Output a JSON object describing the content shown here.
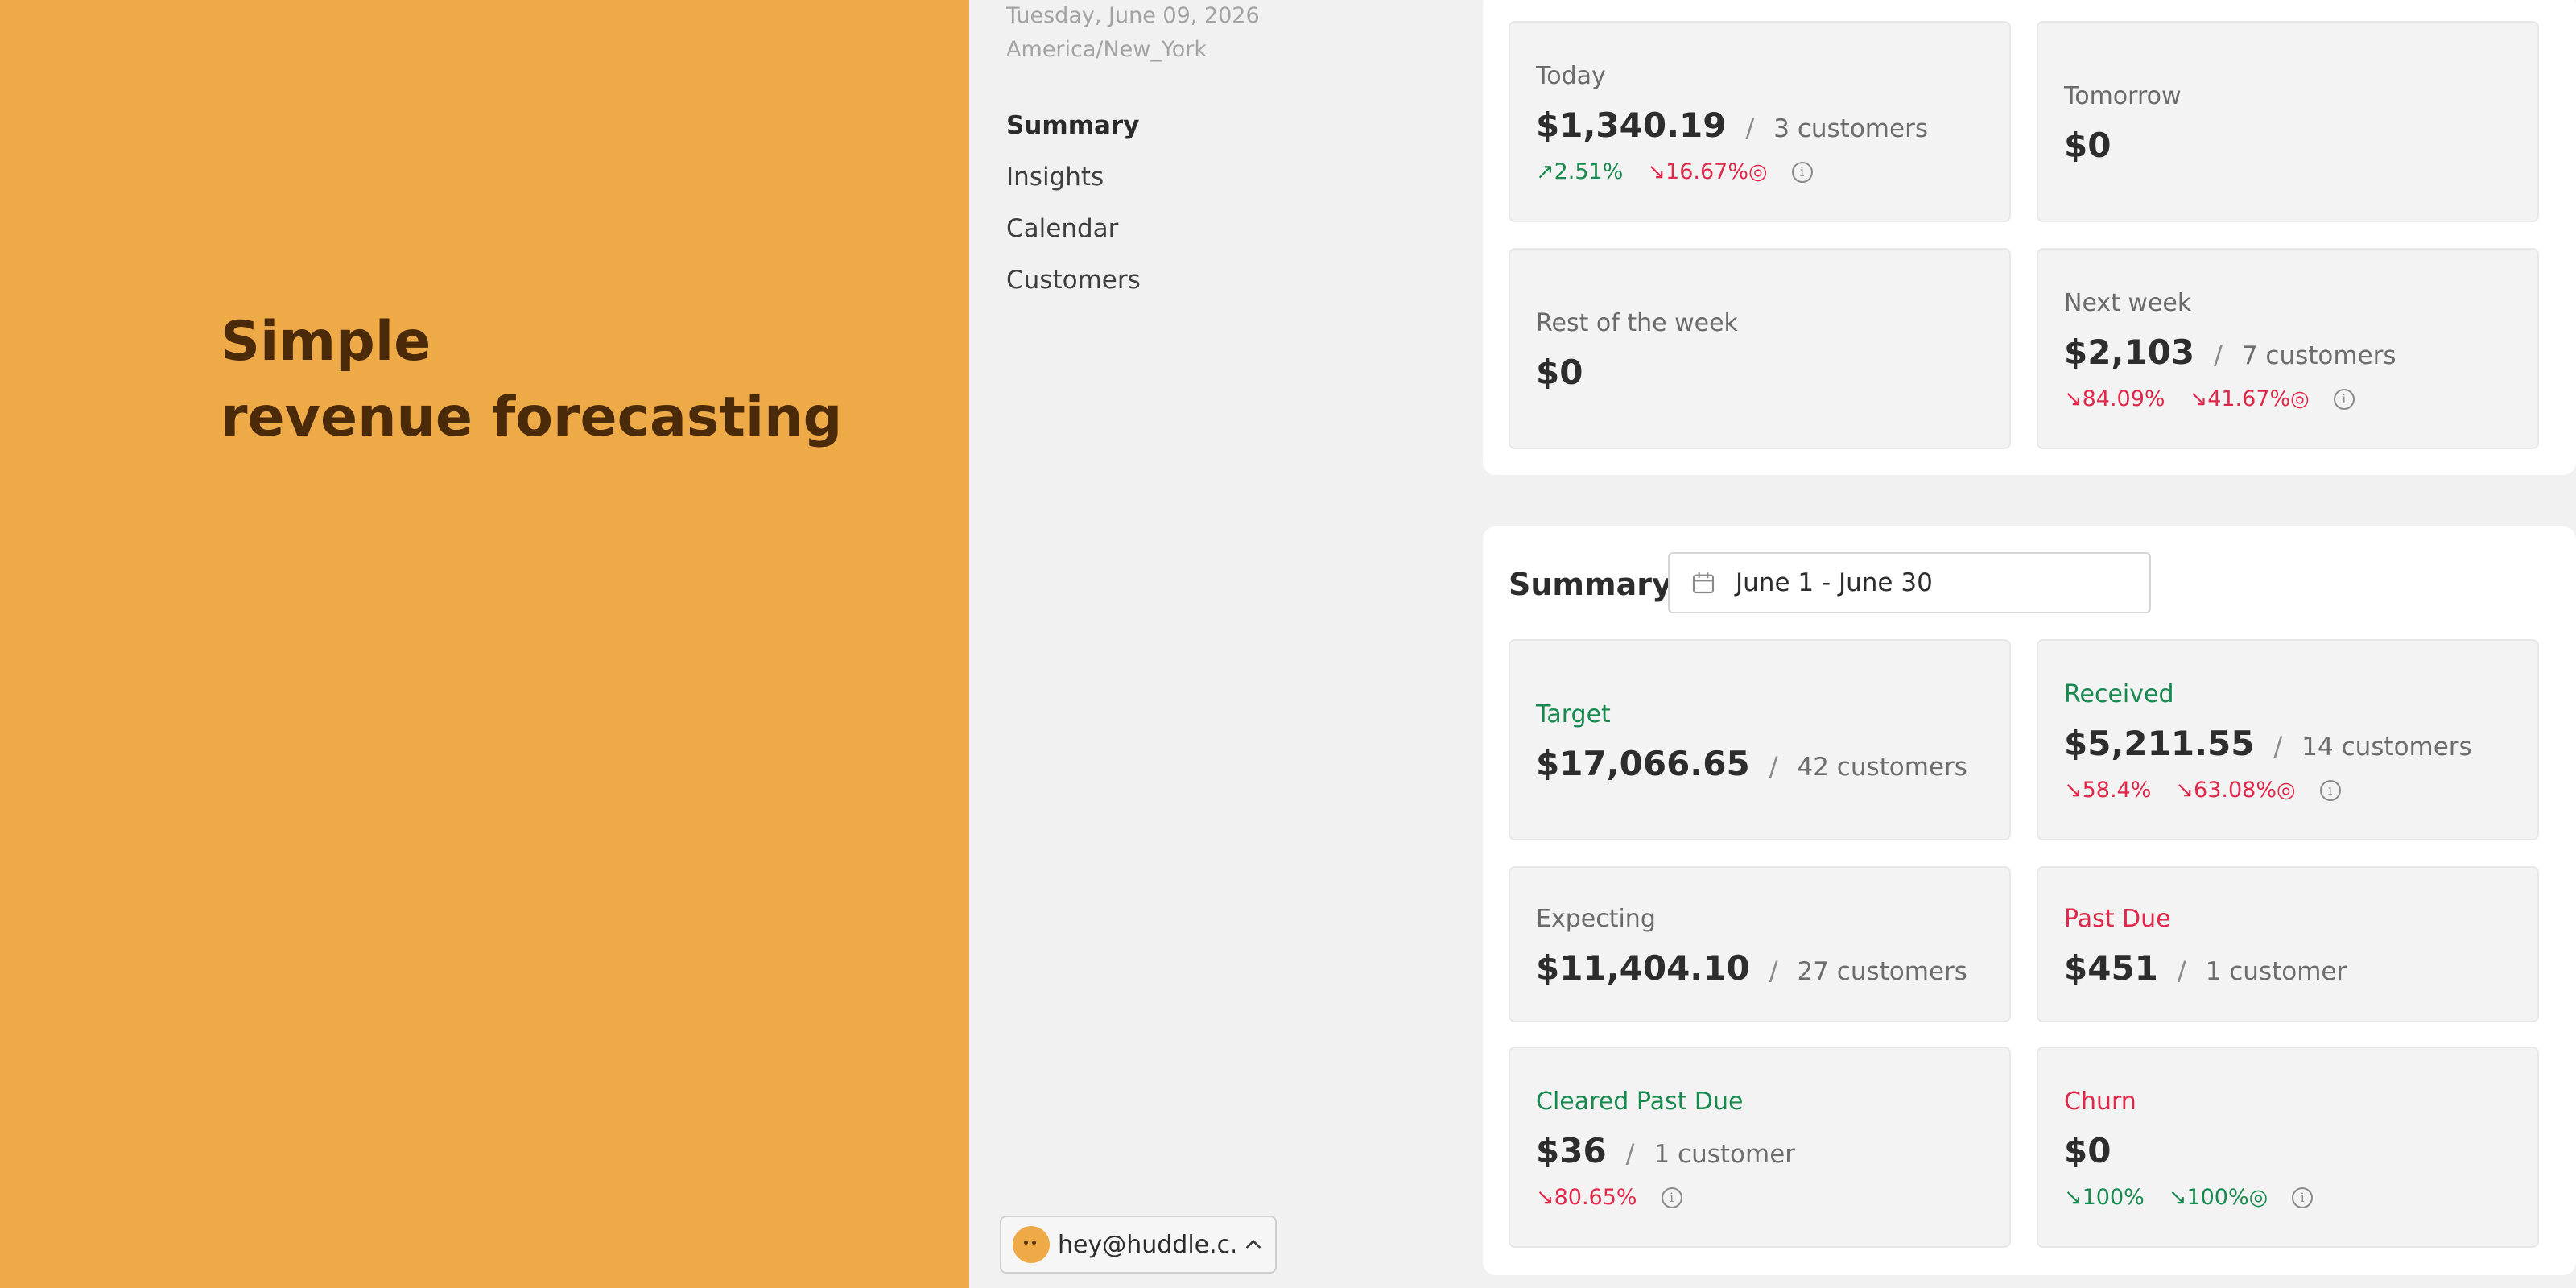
{
  "hero": {
    "line1": "Simple",
    "line2": "revenue forecasting"
  },
  "sidebar": {
    "date": "Tuesday, June 09, 2026",
    "timezone": "America/New_York",
    "nav": [
      "Summary",
      "Insights",
      "Calendar",
      "Customers"
    ],
    "active": "Summary",
    "user_email": "hey@huddle.c..."
  },
  "top_cards": {
    "today": {
      "label": "Today",
      "amount": "$1,340.19",
      "sep": "/",
      "customers": "3 customers",
      "trend1": "↗2.51%",
      "trend2": "↘16.67%◎"
    },
    "tomorrow": {
      "label": "Tomorrow",
      "amount": "$0"
    },
    "rest_week": {
      "label": "Rest of the week",
      "amount": "$0"
    },
    "next_week": {
      "label": "Next week",
      "amount": "$2,103",
      "sep": "/",
      "customers": "7 customers",
      "trend1": "↘84.09%",
      "trend2": "↘41.67%◎"
    }
  },
  "summary": {
    "title": "Summary",
    "date_range": "June 1 - June 30",
    "target": {
      "label": "Target",
      "amount": "$17,066.65",
      "sep": "/",
      "customers": "42 customers"
    },
    "received": {
      "label": "Received",
      "amount": "$5,211.55",
      "sep": "/",
      "customers": "14 customers",
      "trend1": "↘58.4%",
      "trend2": "↘63.08%◎"
    },
    "expecting": {
      "label": "Expecting",
      "amount": "$11,404.10",
      "sep": "/",
      "customers": "27 customers"
    },
    "past_due": {
      "label": "Past Due",
      "amount": "$451",
      "sep": "/",
      "customers": "1 customer"
    },
    "cleared": {
      "label": "Cleared Past Due",
      "amount": "$36",
      "sep": "/",
      "customers": "1 customer",
      "trend1": "↘80.65%"
    },
    "churn": {
      "label": "Churn",
      "amount": "$0",
      "trend1": "↘100%",
      "trend2": "↘100%◎"
    }
  },
  "colors": {
    "hero_bg": "#efaa48",
    "hero_text": "#4a2a08",
    "positive": "#178a4f",
    "negative": "#e0294a",
    "app_bg": "#f2f1f2"
  },
  "icons": {
    "info": "info-icon",
    "calendar": "calendar-icon",
    "chevron": "chevron-up-icon",
    "avatar": "avatar"
  }
}
